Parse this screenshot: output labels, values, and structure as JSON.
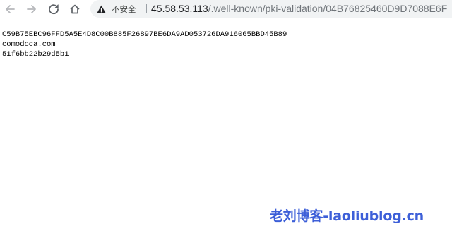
{
  "browser": {
    "address_bar": {
      "security_label": "不安全",
      "url_host": "45.58.53.113",
      "url_path": "/.well-known/pki-validation/04B76825460D9D7088E6F"
    }
  },
  "page": {
    "lines": [
      "C59B75EBC96FFD5A5E4D8C00B885F26897BE6DA9AD053726DA916065BBD45B89",
      "comodoca.com",
      "51f6bb22b29d5b1"
    ]
  },
  "watermark": {
    "text": "老刘博客-laoliublog.cn"
  },
  "colors": {
    "watermark": "#3d5fd8",
    "omnibox_bg": "#f1f3f4",
    "page_bg": "#ffffff"
  },
  "icons": {
    "back": "arrow-left-icon",
    "forward": "arrow-right-icon",
    "reload": "reload-icon",
    "home": "home-icon",
    "security": "warning-triangle-icon"
  }
}
